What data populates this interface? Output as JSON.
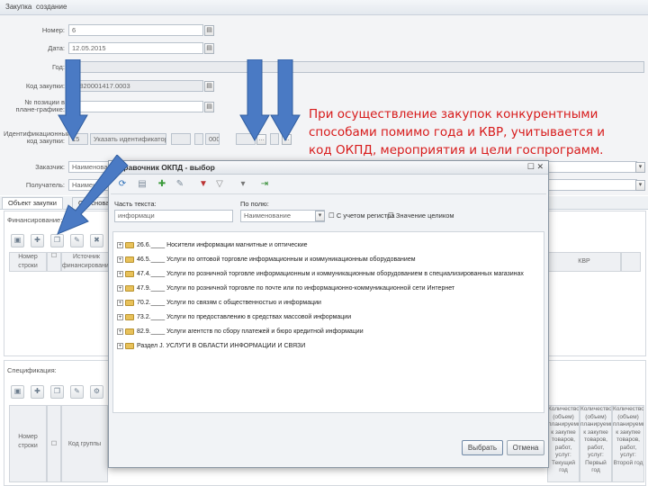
{
  "window": {
    "title": "Закупка",
    "subtitle": "создание"
  },
  "form": {
    "number_label": "Номер:",
    "number_value": "6",
    "date_label": "Дата:",
    "date_value": "12.05.2015",
    "year_label": "Год:",
    "code_label": "Код закупки:",
    "code_value": "15820001417.0003",
    "plan_label": "№ позиции в плане-графике:",
    "ident_label": "Идентификационный код закупки:",
    "ident_prefix": "15",
    "ident_mid": "Указать идентификатор",
    "ident_suffix": "000",
    "customer_label": "Заказчик:",
    "customer_value": "Наименование",
    "recipient_label": "Получатель:",
    "recipient_value": "Наименование"
  },
  "tabs": [
    {
      "label": "Объект закупки"
    },
    {
      "label": "Обоснование"
    }
  ],
  "financing": {
    "label": "Финансирование:",
    "col_row": "Номер строки",
    "col_source": "Источник финансирования",
    "col_kvr": "КВР"
  },
  "spec": {
    "label": "Спецификация:",
    "col_row": "Номер строки",
    "col_group": "Код группы",
    "col_qty1": "Количество (объем) планируемых к закупке товаров, работ, услуг: Текущий год",
    "col_qty2": "Количество (объем) планируемых к закупке товаров, работ, услуг: Первый год",
    "col_qty3": "Количество (объем) планируемых к закупке товаров, работ, услуг: Второй год"
  },
  "dialog": {
    "title": "Справочник ОКПД - выбор",
    "search_label": "Часть текста:",
    "search_value": "информаци",
    "field_label": "По полю:",
    "field_value": "Наименование",
    "case_label": "С учетом регистра",
    "whole_label": "Значение целиком",
    "tree": [
      {
        "code": "26.6.____",
        "text": "Носители информации магнитные и оптические"
      },
      {
        "code": "46.5.____",
        "text": "Услуги по оптовой торговле информационным и коммуникационным оборудованием"
      },
      {
        "code": "47.4.____",
        "text": "Услуги по розничной торговле информационным и коммуникационным оборудованием в специализированных магазинах"
      },
      {
        "code": "47.9.____",
        "text": "Услуги по розничной торговле по почте или по информационно-коммуникационной сети Интернет"
      },
      {
        "code": "70.2.____",
        "text": "Услуги по связям с общественностью и информации"
      },
      {
        "code": "73.2.____",
        "text": "Услуги по предоставлению в средствах массовой информации"
      },
      {
        "code": "82.9.____",
        "text": "Услуги агентств по сбору платежей и бюро кредитной информации"
      },
      {
        "code": "Раздел J.",
        "text": "УСЛУГИ В ОБЛАСТИ ИНФОРМАЦИИ И СВЯЗИ"
      }
    ],
    "select_btn": "Выбрать",
    "cancel_btn": "Отмена"
  },
  "callout": {
    "line1": "При осуществление закупок конкурентными",
    "line2": "способами помимо года и КВР, учитывается и",
    "line3": "код ОКПД, мероприятия и цели госпрограмм."
  },
  "colors": {
    "arrow": "#4a7ac4",
    "callout": "#d71a1a",
    "folder": "#e8c15a"
  }
}
